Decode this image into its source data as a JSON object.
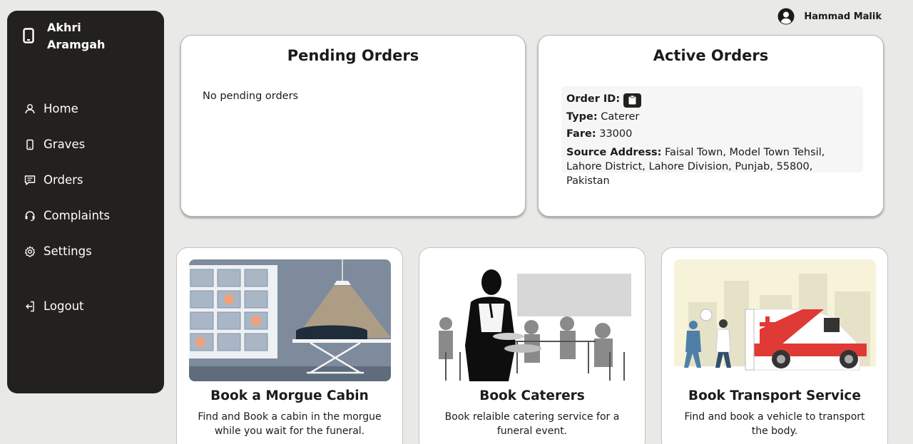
{
  "app": {
    "name": "Akhri Aramgah"
  },
  "sidebar": {
    "items": [
      {
        "label": "Home",
        "icon": "user-icon"
      },
      {
        "label": "Graves",
        "icon": "phone-icon"
      },
      {
        "label": "Orders",
        "icon": "message-icon"
      },
      {
        "label": "Complaints",
        "icon": "headset-icon"
      },
      {
        "label": "Settings",
        "icon": "gear-icon"
      },
      {
        "label": "Logout",
        "icon": "logout-icon"
      }
    ]
  },
  "header": {
    "user_name": "Hammad Malik"
  },
  "pending_orders": {
    "title": "Pending Orders",
    "empty_message": "No pending orders"
  },
  "active_orders": {
    "title": "Active Orders",
    "order": {
      "order_id_label": "Order ID:",
      "type_label": "Type:",
      "type_value": "Caterer",
      "fare_label": "Fare:",
      "fare_value": "33000",
      "address_label": "Source Address:",
      "address_value": "Faisal Town, Model Town Tehsil, Lahore District, Lahore Division, Punjab, 55800, Pakistan"
    }
  },
  "services": [
    {
      "title": "Book a Morgue Cabin",
      "description": "Find and Book a cabin in the morgue while you wait for the funeral."
    },
    {
      "title": "Book Caterers",
      "description": "Book relaible catering service for a funeral event."
    },
    {
      "title": "Book Transport Service",
      "description": "Find and book a vehicle to transport the body."
    }
  ],
  "colors": {
    "sidebar_bg": "#22211e",
    "page_bg": "#e9e9e7",
    "card_bg": "#ffffff",
    "ambulance_red": "#e03a36"
  }
}
